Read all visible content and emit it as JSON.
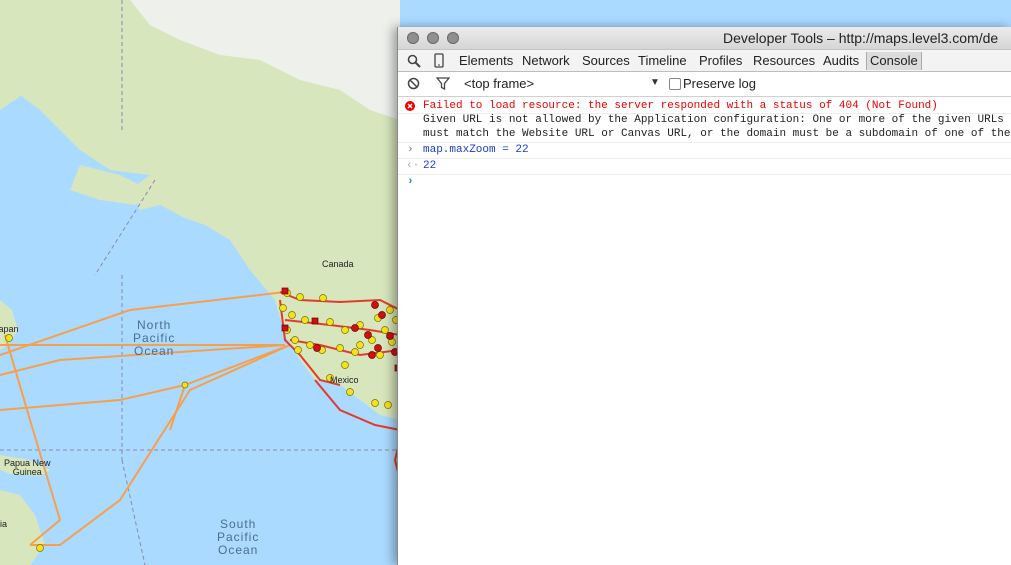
{
  "map": {
    "ocean_labels": [
      {
        "text_lines": [
          "North",
          "Pacific",
          "Ocean"
        ]
      },
      {
        "text_lines": [
          "South",
          "Pacific",
          "Ocean"
        ]
      }
    ],
    "land_labels": {
      "canada": "Canada",
      "japan": "Japan",
      "mexico": "Mexico",
      "png": [
        "Papua New",
        "Guinea"
      ],
      "australia": "lia"
    }
  },
  "devtools": {
    "title": "Developer Tools – http://maps.level3.com/de",
    "tabs": [
      "Elements",
      "Network",
      "Sources",
      "Timeline",
      "Profiles",
      "Resources",
      "Audits",
      "Console"
    ],
    "active_tab": "Console",
    "toolbar": {
      "frame_select": "<top frame>",
      "preserve_log_label": "Preserve log",
      "preserve_log_checked": false
    },
    "console": {
      "error_line": "Failed to load resource: the server responded with a status of 404 (Not Found)",
      "message_line1": "Given URL is not allowed by the Application configuration: One or more of the given URLs",
      "message_line2": "must match the Website URL or Canvas URL, or the domain must be a subdomain of one of the",
      "input_line": "map.maxZoom = 22",
      "result_line": "22"
    }
  },
  "colors": {
    "ocean": "#aadaff",
    "land": "#cfe2b0",
    "cable_orange": "#f7a04c",
    "cable_red": "#e33b2b",
    "node_yellow": "#f4e21a",
    "node_red": "#d01010",
    "error_red": "#e00000",
    "console_blue": "#1a3bd0"
  }
}
